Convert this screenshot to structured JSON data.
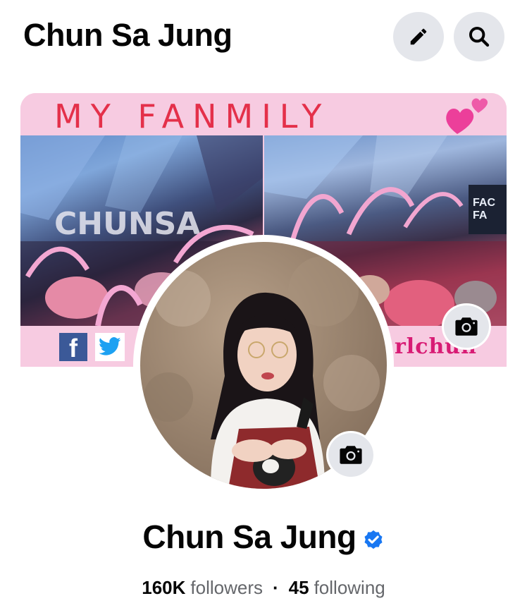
{
  "header": {
    "title": "Chun Sa Jung",
    "edit_icon": "pencil-icon",
    "search_icon": "search-icon"
  },
  "cover": {
    "banner_title": "MY FANMILY",
    "handle_fragment": "rlchun",
    "side_text_left": "CHUNSA",
    "facebook_icon": "facebook-logo-icon",
    "twitter_icon": "twitter-logo-icon",
    "camera_icon": "camera-icon",
    "banner_color": "#f7cbe1",
    "title_color": "#e4304a"
  },
  "profile": {
    "name": "Chun Sa Jung",
    "verified_icon": "verified-badge-icon",
    "verified_color": "#1877f2",
    "camera_icon": "camera-icon",
    "followers_count": "160K",
    "followers_label": "followers",
    "separator": "·",
    "following_count": "45",
    "following_label": "following"
  }
}
